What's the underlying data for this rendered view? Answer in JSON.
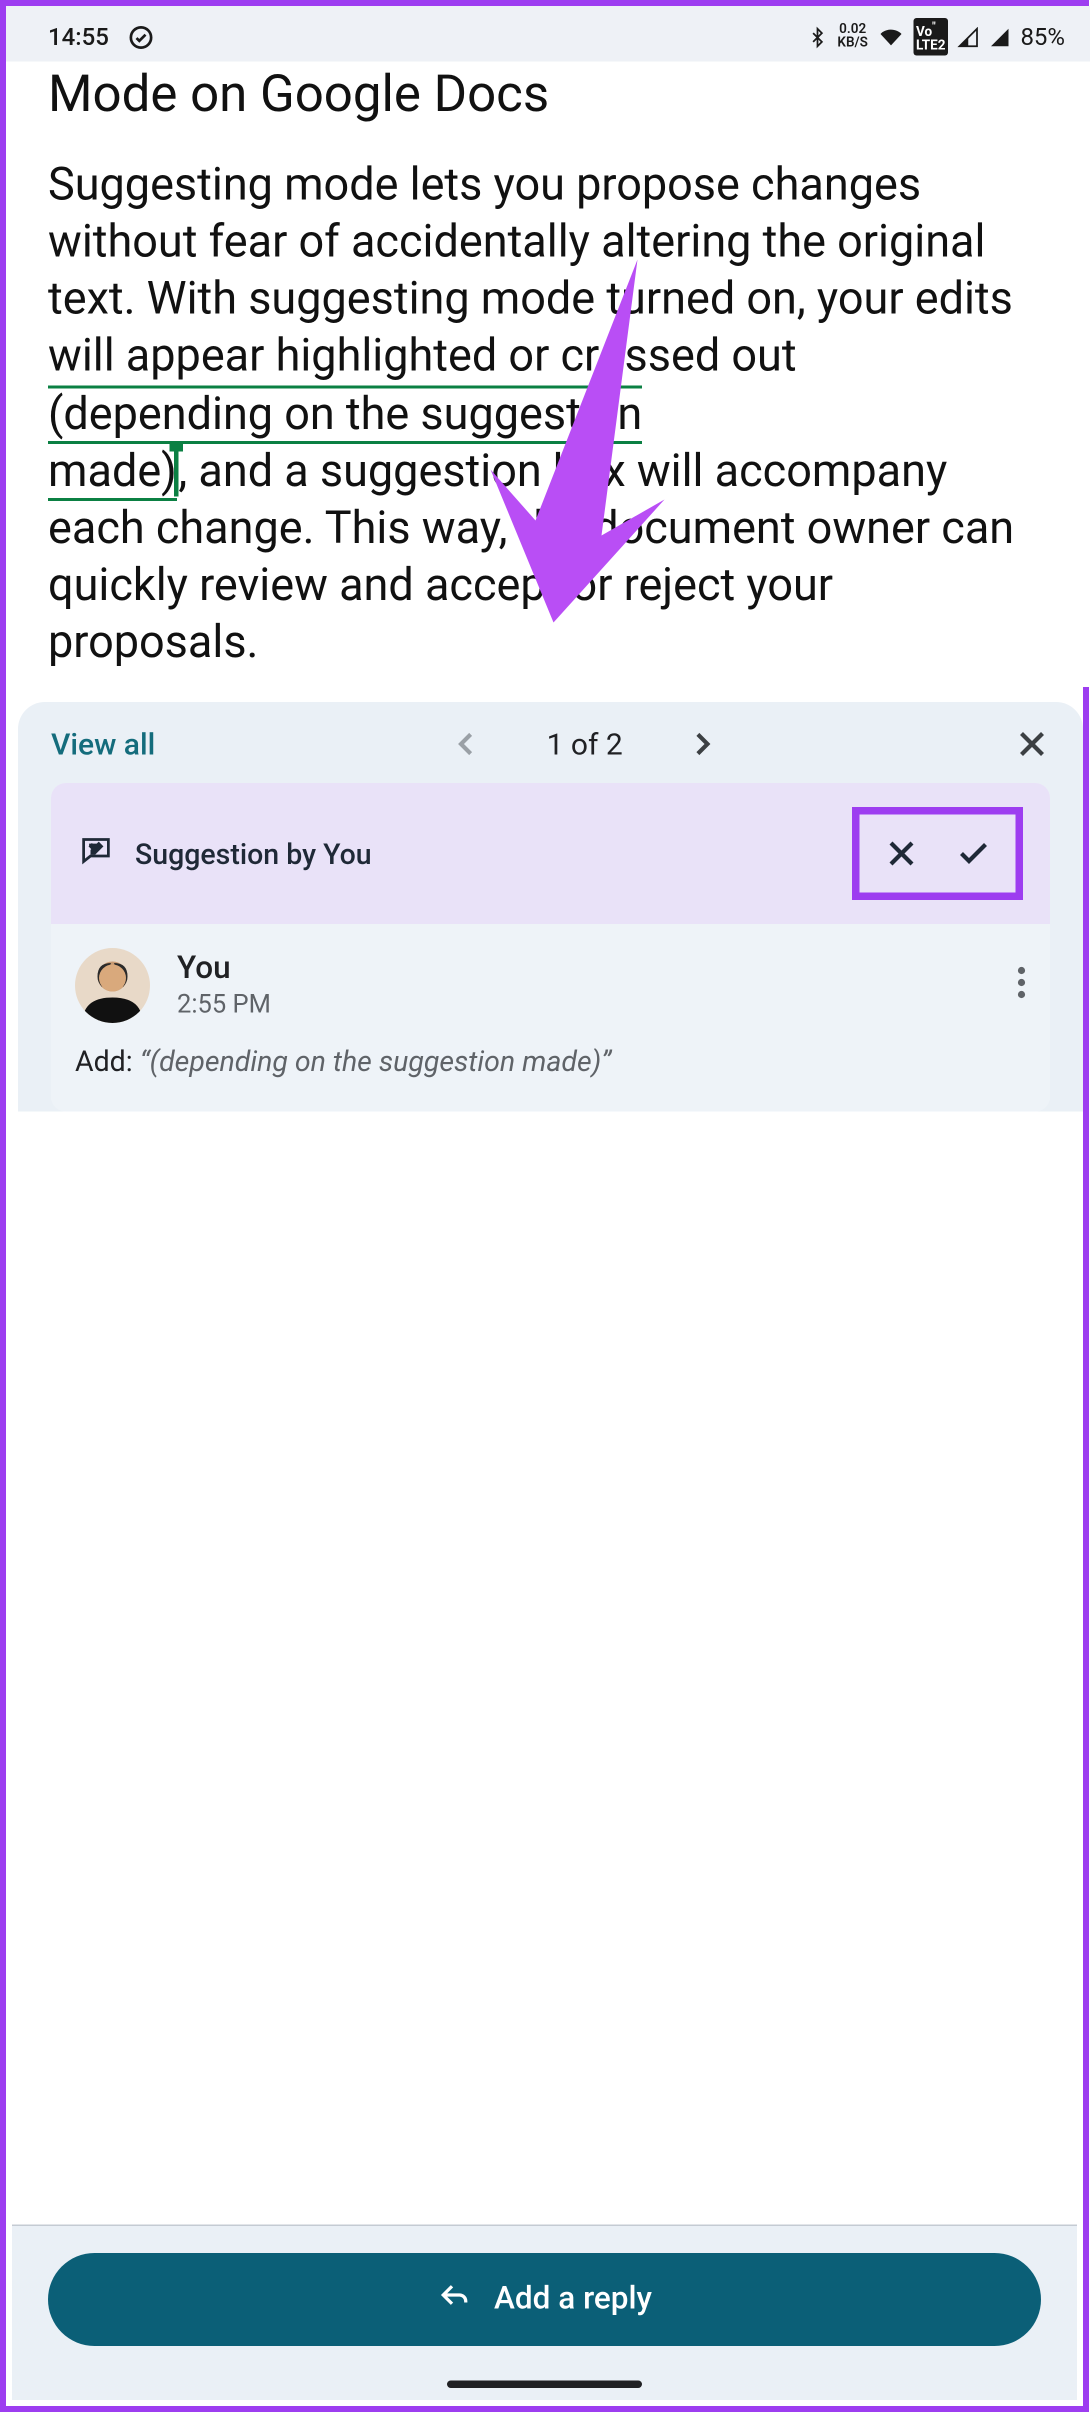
{
  "status": {
    "time": "14:55",
    "kbs_value": "0.02",
    "kbs_label": "KB/S",
    "volte": "VoLTE2",
    "battery": "85%"
  },
  "doc": {
    "heading_partial": "Mode on Google Docs",
    "body_before": "Suggesting mode lets you propose changes without fear of accidentally altering the original text. With suggesting mode turned on, your edits will appear highlighted or crossed out ",
    "body_suggested1": "(depending on the suggestion",
    "body_suggested2": "made)",
    "body_after": ", and a suggestion box will accompany each change. This way, the document owner can quickly review and accept or reject your proposals."
  },
  "panel": {
    "view_all": "View all",
    "counter": "1 of 2",
    "card_title": "Suggestion by You",
    "author": "You",
    "time": "2:55 PM",
    "action_prefix": "Add: ",
    "action_text": "“(depending on the suggestion made)”",
    "reply_label": "Add a reply"
  },
  "colors": {
    "accent_border": "#9d3df0",
    "suggest_green": "#0b8043",
    "teal": "#146c7c",
    "reply_bg": "#0b5f77"
  }
}
